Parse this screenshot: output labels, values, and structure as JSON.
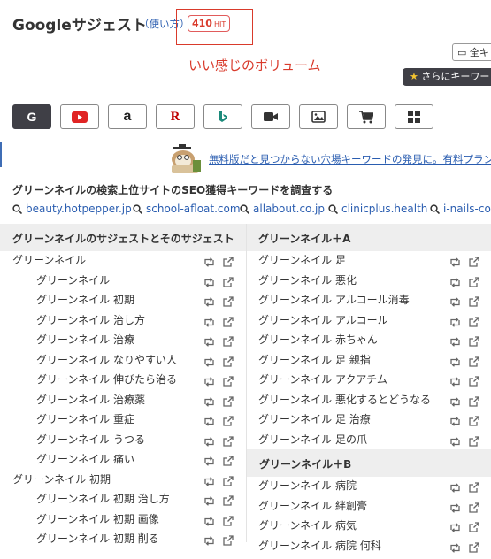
{
  "header": {
    "title": "Googleサジェスト",
    "howto": "（使い方）",
    "hit_count": "410",
    "hit_unit": "HIT",
    "annotation": "いい感じのボリューム",
    "copy_label": "全キ",
    "more_label": "さらにキーワー"
  },
  "sources": [
    {
      "name": "google",
      "active": true
    },
    {
      "name": "youtube",
      "active": false
    },
    {
      "name": "amazon",
      "active": false
    },
    {
      "name": "rakuten",
      "active": false
    },
    {
      "name": "bing",
      "active": false
    },
    {
      "name": "video",
      "active": false
    },
    {
      "name": "image",
      "active": false
    },
    {
      "name": "shopping",
      "active": false
    },
    {
      "name": "apps",
      "active": false
    }
  ],
  "promo": "無料版だと見つからない穴場キーワードの発見に。有料プラン",
  "seo": {
    "heading": "グリーンネイルの検索上位サイトのSEO獲得キーワードを調査する",
    "sites": [
      "beauty.hotpepper.jp",
      "school-afloat.com",
      "allabout.co.jp",
      "clinicplus.health",
      "i-nails-co.j"
    ]
  },
  "left_column": {
    "heading": "グリーンネイルのサジェストとそのサジェスト",
    "rows": [
      {
        "text": "グリーンネイル",
        "level": 0
      },
      {
        "text": "グリーンネイル",
        "level": 1
      },
      {
        "text": "グリーンネイル 初期",
        "level": 1
      },
      {
        "text": "グリーンネイル 治し方",
        "level": 1
      },
      {
        "text": "グリーンネイル 治療",
        "level": 1
      },
      {
        "text": "グリーンネイル なりやすい人",
        "level": 1
      },
      {
        "text": "グリーンネイル 伸びたら治る",
        "level": 1
      },
      {
        "text": "グリーンネイル 治療薬",
        "level": 1
      },
      {
        "text": "グリーンネイル 重症",
        "level": 1
      },
      {
        "text": "グリーンネイル うつる",
        "level": 1
      },
      {
        "text": "グリーンネイル 痛い",
        "level": 1
      },
      {
        "text": "グリーンネイル 初期",
        "level": 0
      },
      {
        "text": "グリーンネイル 初期 治し方",
        "level": 1
      },
      {
        "text": "グリーンネイル 初期 画像",
        "level": 1
      },
      {
        "text": "グリーンネイル 初期 削る",
        "level": 1
      }
    ]
  },
  "right_column": {
    "heading_a": "グリーンネイル＋A",
    "rows_a": [
      "グリーンネイル 足",
      "グリーンネイル 悪化",
      "グリーンネイル アルコール消毒",
      "グリーンネイル アルコール",
      "グリーンネイル 赤ちゃん",
      "グリーンネイル 足 親指",
      "グリーンネイル アクアチム",
      "グリーンネイル 悪化するとどうなる",
      "グリーンネイル 足 治療",
      "グリーンネイル 足の爪"
    ],
    "heading_b": "グリーンネイル＋B",
    "rows_b": [
      "グリーンネイル 病院",
      "グリーンネイル 絆創膏",
      "グリーンネイル 病気",
      "グリーンネイル 病院 何科"
    ]
  },
  "colors": {
    "link": "#2a5db0",
    "annotation": "#d93a2b",
    "dark_button": "#3f3f46",
    "header_bg": "#eeeeee"
  }
}
